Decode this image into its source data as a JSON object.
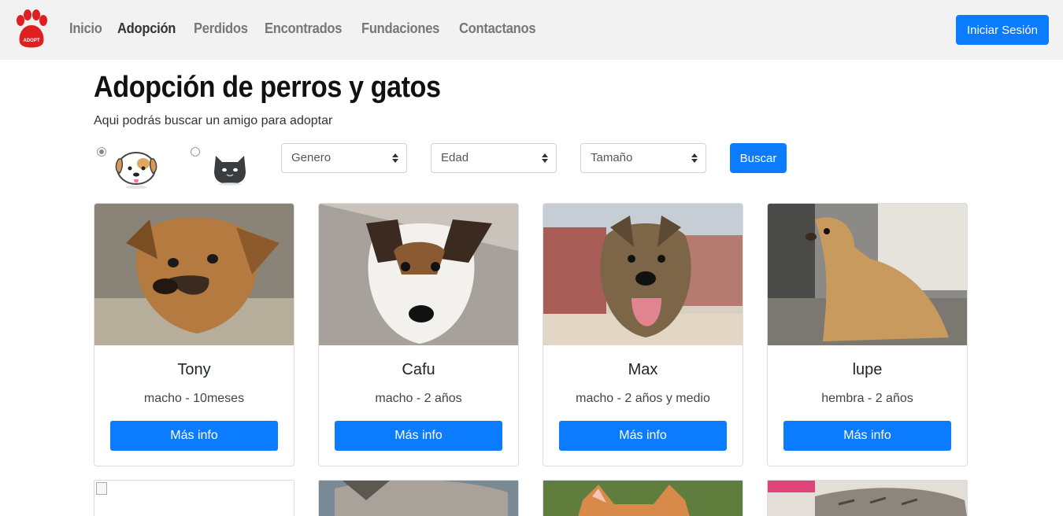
{
  "nav": {
    "logo_text": "ADOPT",
    "links": [
      "Inicio",
      "Adopción",
      "Perdidos",
      "Encontrados",
      "Fundaciones",
      "Contactanos"
    ],
    "active_index": 1,
    "login_label": "Iniciar Sesión"
  },
  "header": {
    "title": "Adopción de perros y gatos",
    "subtitle": "Aqui podrás buscar un amigo para adoptar"
  },
  "filters": {
    "pet_type_selected": "dog",
    "genero": "Genero",
    "edad": "Edad",
    "tamano": "Tamaño",
    "search_label": "Buscar"
  },
  "cards": [
    {
      "name": "Tony",
      "info": "macho - 10meses",
      "button": "Más info"
    },
    {
      "name": "Cafu",
      "info": "macho - 2 años",
      "button": "Más info"
    },
    {
      "name": "Max",
      "info": "macho - 2 años y medio",
      "button": "Más info"
    },
    {
      "name": "lupe",
      "info": "hembra - 2 años",
      "button": "Más info"
    }
  ],
  "colors": {
    "primary": "#0b7cff",
    "navbar_bg": "#f2f2f2",
    "logo_red": "#e02020"
  }
}
